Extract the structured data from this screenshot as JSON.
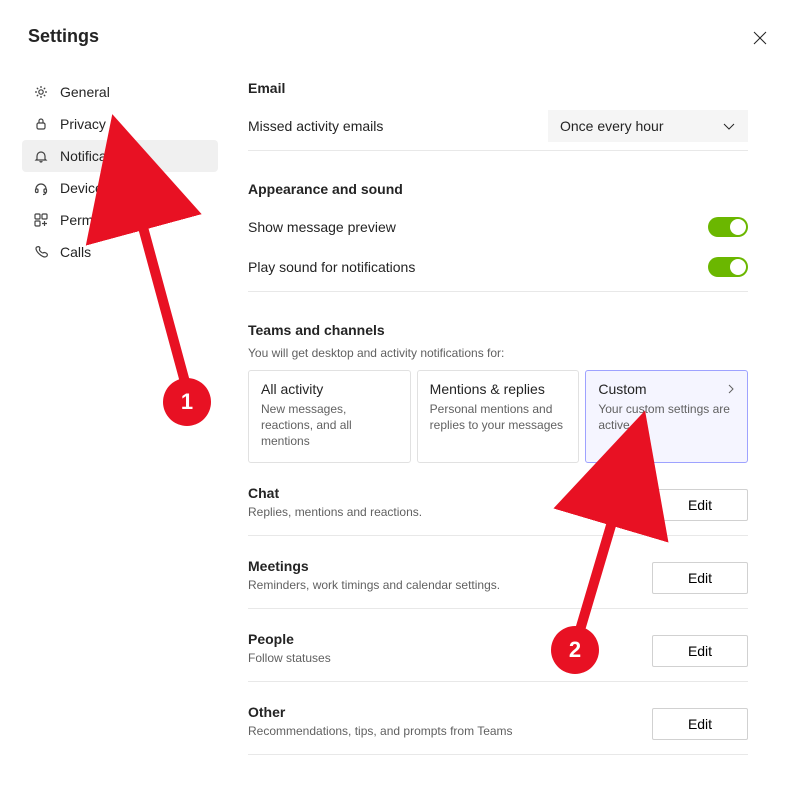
{
  "title": "Settings",
  "sidebar": {
    "items": [
      {
        "label": "General"
      },
      {
        "label": "Privacy"
      },
      {
        "label": "Notifications"
      },
      {
        "label": "Devices"
      },
      {
        "label": "Permissions"
      },
      {
        "label": "Calls"
      }
    ]
  },
  "email": {
    "heading": "Email",
    "missed_label": "Missed activity emails",
    "missed_value": "Once every hour"
  },
  "appearance": {
    "heading": "Appearance and sound",
    "preview_label": "Show message preview",
    "sound_label": "Play sound for notifications"
  },
  "teams": {
    "heading": "Teams and channels",
    "sub": "You will get desktop and activity notifications for:",
    "cards": [
      {
        "title": "All activity",
        "desc": "New messages, reactions, and all mentions"
      },
      {
        "title": "Mentions & replies",
        "desc": "Personal mentions and replies to your messages"
      },
      {
        "title": "Custom",
        "desc": "Your custom settings are active."
      }
    ]
  },
  "sections": [
    {
      "title": "Chat",
      "desc": "Replies, mentions and reactions.",
      "btn": "Edit"
    },
    {
      "title": "Meetings",
      "desc": "Reminders, work timings and calendar settings.",
      "btn": "Edit"
    },
    {
      "title": "People",
      "desc": "Follow statuses",
      "btn": "Edit"
    },
    {
      "title": "Other",
      "desc": "Recommendations, tips, and prompts from Teams",
      "btn": "Edit"
    }
  ],
  "annotations": {
    "a1": "1",
    "a2": "2"
  }
}
